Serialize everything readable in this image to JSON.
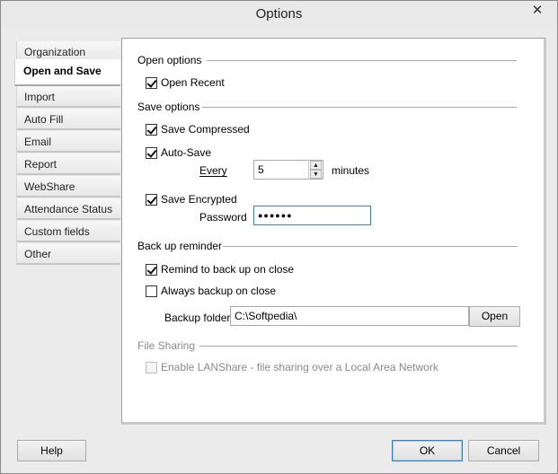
{
  "window": {
    "title": "Options",
    "close_glyph": "✕"
  },
  "sidebar": {
    "items": [
      {
        "label": "Organization"
      },
      {
        "label": "Open and Save"
      },
      {
        "label": "Import"
      },
      {
        "label": "Auto Fill"
      },
      {
        "label": "Email"
      },
      {
        "label": "Report"
      },
      {
        "label": "WebShare"
      },
      {
        "label": "Attendance Status"
      },
      {
        "label": "Custom fields"
      },
      {
        "label": "Other"
      }
    ],
    "selected": "Open and Save"
  },
  "open_options": {
    "header": "Open options",
    "open_recent": {
      "label": "Open Recent",
      "checked": true
    }
  },
  "save_options": {
    "header": "Save options",
    "save_compressed": {
      "label": "Save Compressed",
      "checked": true
    },
    "auto_save": {
      "label": "Auto-Save",
      "checked": true
    },
    "every_label": "Every",
    "every_value": "5",
    "minutes_label": "minutes",
    "save_encrypted": {
      "label": "Save Encrypted",
      "checked": true
    },
    "password_label": "Password",
    "password_value": "●●●●●●"
  },
  "backup": {
    "header": "Back up reminder",
    "remind": {
      "label": "Remind to back up on close",
      "checked": true
    },
    "always": {
      "label": "Always backup on close",
      "checked": false
    },
    "folder_label": "Backup folder",
    "folder_value": "C:\\Softpedia\\",
    "open_label": "Open"
  },
  "file_sharing": {
    "header": "File Sharing",
    "lanshare": {
      "label": "Enable LANShare - file sharing over a Local Area Network",
      "checked": false
    }
  },
  "footer": {
    "help_label": "Help",
    "ok_label": "OK",
    "cancel_label": "Cancel"
  }
}
